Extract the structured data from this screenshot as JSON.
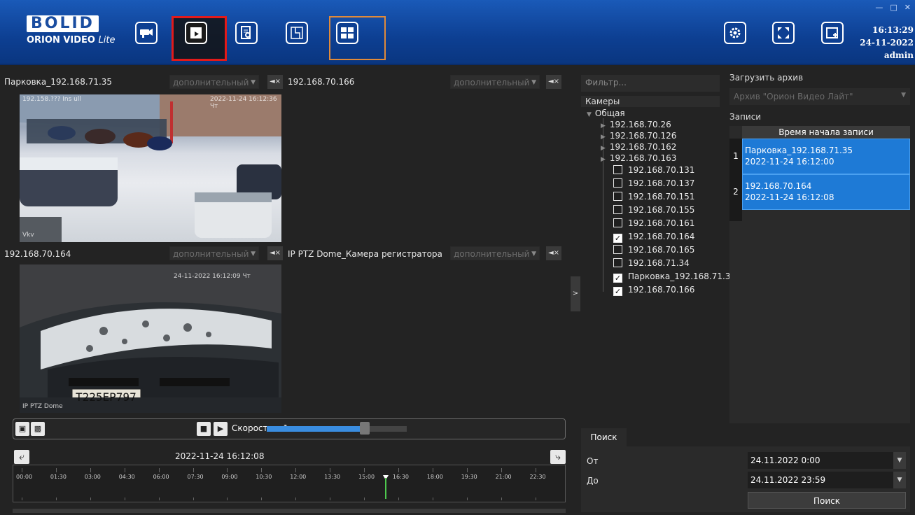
{
  "app": {
    "logo_main": "BOLID",
    "logo_sub": "ORION VIDEO",
    "logo_sub_suffix": "Lite",
    "clock_time": "16:13:29",
    "clock_date": "24-11-2022",
    "user": "admin"
  },
  "panes": [
    {
      "title": "Парковка_192.168.71.35",
      "stream": "дополнительный",
      "overlay_ts": "2022-11-24 16:12:36 Чт",
      "overlay_name": "Vkv"
    },
    {
      "title": "192.168.70.166",
      "stream": "дополнительный"
    },
    {
      "title": "192.168.70.164",
      "stream": "дополнительный",
      "overlay_ts": "24-11-2022 16:12:09 Чт",
      "overlay_name": "IP PTZ Dome",
      "plate": "T225EP797"
    },
    {
      "title": "IP PTZ Dome_Камера регистратора",
      "stream": "дополнительный"
    }
  ],
  "playback": {
    "speed_label": "Скорость: x1",
    "speed_fraction": 0.7,
    "datetime": "2022-11-24 16:12:08",
    "ticks": [
      "00:00",
      "01:30",
      "03:00",
      "04:30",
      "06:00",
      "07:30",
      "09:00",
      "10:30",
      "12:00",
      "13:30",
      "15:00",
      "16:30",
      "18:00",
      "19:30",
      "21:00",
      "22:30"
    ]
  },
  "filter_placeholder": "Фильтр...",
  "cameras": {
    "header": "Камеры",
    "group": "Общая",
    "folders": [
      "192.168.70.26",
      "192.168.70.126",
      "192.168.70.162",
      "192.168.70.163"
    ],
    "items": [
      {
        "name": "192.168.70.131",
        "checked": false
      },
      {
        "name": "192.168.70.137",
        "checked": false
      },
      {
        "name": "192.168.70.151",
        "checked": false
      },
      {
        "name": "192.168.70.155",
        "checked": false
      },
      {
        "name": "192.168.70.161",
        "checked": false
      },
      {
        "name": "192.168.70.164",
        "checked": true
      },
      {
        "name": "192.168.70.165",
        "checked": false
      },
      {
        "name": "192.168.71.34",
        "checked": false
      },
      {
        "name": "Парковка_192.168.71.3",
        "checked": true
      },
      {
        "name": "192.168.70.166",
        "checked": true
      }
    ]
  },
  "archive": {
    "label": "Загрузить архив",
    "selected": "Архив \"Орион Видео Лайт\"",
    "records_label": "Записи",
    "column": "Время начала записи",
    "records": [
      {
        "idx": "1",
        "name": "Парковка_192.168.71.35",
        "time": "2022-11-24 16:12:00"
      },
      {
        "idx": "2",
        "name": "192.168.70.164",
        "time": "2022-11-24 16:12:08"
      }
    ]
  },
  "search": {
    "tab": "Поиск",
    "from_label": "От",
    "to_label": "До",
    "from": "24.11.2022 0:00",
    "to": "24.11.2022 23:59",
    "button": "Поиск"
  }
}
